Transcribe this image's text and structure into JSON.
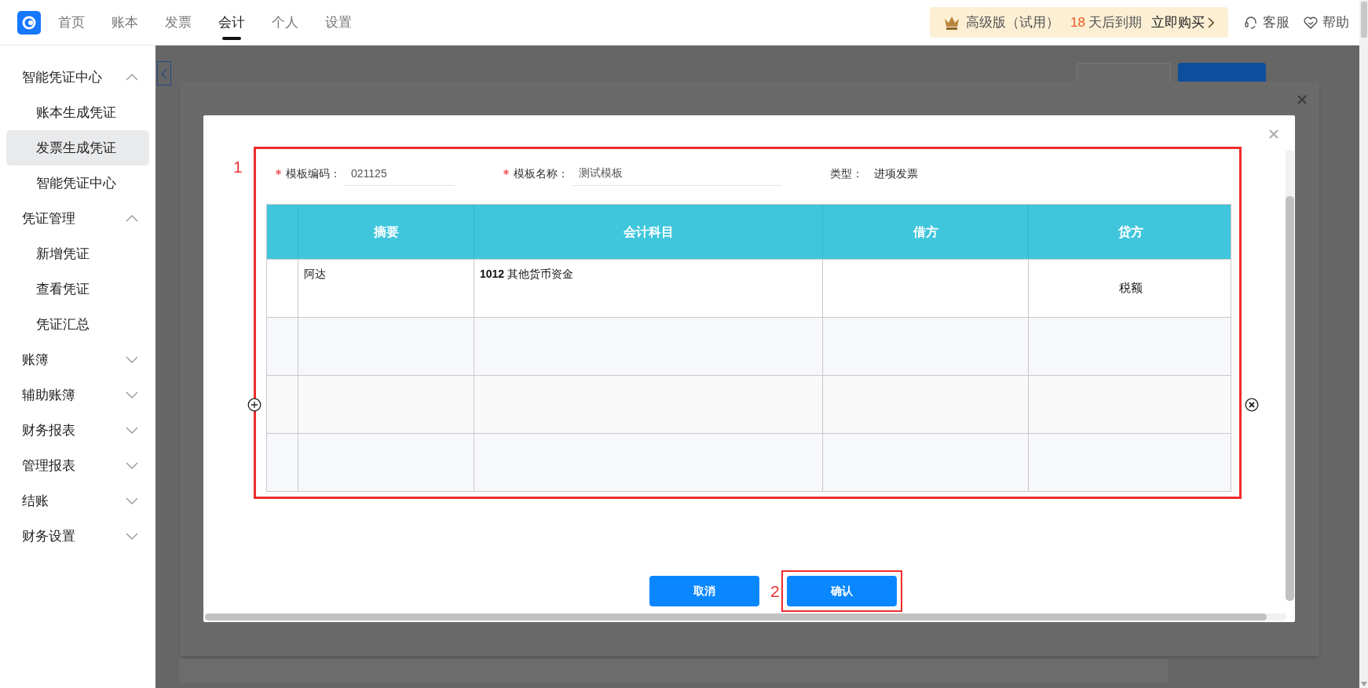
{
  "top_nav": {
    "tabs": [
      {
        "label": "首页",
        "selected": false
      },
      {
        "label": "账本",
        "selected": false
      },
      {
        "label": "发票",
        "selected": false
      },
      {
        "label": "会计",
        "selected": true
      },
      {
        "label": "个人",
        "selected": false
      },
      {
        "label": "设置",
        "selected": false
      }
    ]
  },
  "trial_banner": {
    "edition": "高级版（试用）",
    "days": "18",
    "days_suffix": "天后到期",
    "action": "立即购买"
  },
  "header_links": [
    {
      "kind": "support",
      "label": "客服"
    },
    {
      "kind": "help",
      "label": "帮助"
    }
  ],
  "sidebar": {
    "sections": [
      {
        "label": "智能凭证中心",
        "expanded": true,
        "children": [
          {
            "label": "账本生成凭证",
            "selected": false
          },
          {
            "label": "发票生成凭证",
            "selected": true
          },
          {
            "label": "智能凭证中心",
            "selected": false
          }
        ]
      },
      {
        "label": "凭证管理",
        "expanded": true,
        "children": [
          {
            "label": "新增凭证",
            "selected": false
          },
          {
            "label": "查看凭证",
            "selected": false
          },
          {
            "label": "凭证汇总",
            "selected": false
          }
        ]
      },
      {
        "label": "账簿",
        "expanded": false
      },
      {
        "label": "辅助账簿",
        "expanded": false
      },
      {
        "label": "财务报表",
        "expanded": false
      },
      {
        "label": "管理报表",
        "expanded": false
      },
      {
        "label": "结账",
        "expanded": false
      },
      {
        "label": "财务设置",
        "expanded": false
      }
    ]
  },
  "background_page": {
    "buttons": [
      {
        "kind": "secondary"
      },
      {
        "kind": "primary"
      }
    ]
  },
  "dialog": {
    "annotation": "1",
    "fields": [
      {
        "kind": "input",
        "required": true,
        "label": "模板编码：",
        "value": "021125"
      },
      {
        "kind": "input",
        "required": true,
        "label": "模板名称：",
        "value": "测试模板"
      },
      {
        "kind": "text",
        "required": false,
        "label": "类型：",
        "value": "进项发票"
      }
    ],
    "table": {
      "columns": [
        {
          "label": "摘要"
        },
        {
          "label": "会计科目"
        },
        {
          "label": "借方"
        },
        {
          "label": "贷方"
        }
      ],
      "rows": [
        {
          "summary": "阿达",
          "account": "**1012** 其他货币资金",
          "credit": "税额"
        },
        {},
        {},
        {}
      ]
    },
    "buttons": [
      {
        "label": "取消"
      },
      {
        "label": "确认",
        "annotation": "2"
      }
    ]
  }
}
